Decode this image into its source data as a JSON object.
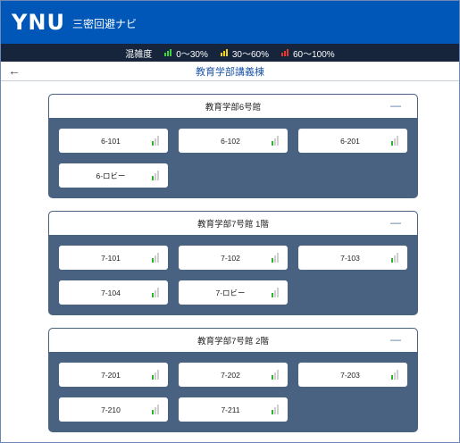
{
  "header": {
    "logo": "YNU",
    "subtitle": "三密回避ナビ",
    "background": "#0057b7"
  },
  "legend": {
    "label": "混雑度",
    "items": [
      {
        "range": "0〜30%",
        "color": "#3fd13f",
        "icon": "signal-low-icon"
      },
      {
        "range": "30〜60%",
        "color": "#f2d21b",
        "icon": "signal-mid-icon"
      },
      {
        "range": "60〜100%",
        "color": "#e23b2e",
        "icon": "signal-high-icon"
      }
    ]
  },
  "nav": {
    "back": "←",
    "title": "教育学部講義棟"
  },
  "sections": [
    {
      "title": "教育学部6号館",
      "toggle": "—",
      "rooms": [
        "6-101",
        "6-102",
        "6-201",
        "6-ロビー"
      ]
    },
    {
      "title": "教育学部7号館 1階",
      "toggle": "—",
      "rooms": [
        "7-101",
        "7-102",
        "7-103",
        "7-104",
        "7-ロビー"
      ]
    },
    {
      "title": "教育学部7号館 2階",
      "toggle": "—",
      "rooms": [
        "7-201",
        "7-202",
        "7-203",
        "7-210",
        "7-211"
      ]
    }
  ],
  "crowd_level": "low",
  "accent": "#4a6281"
}
